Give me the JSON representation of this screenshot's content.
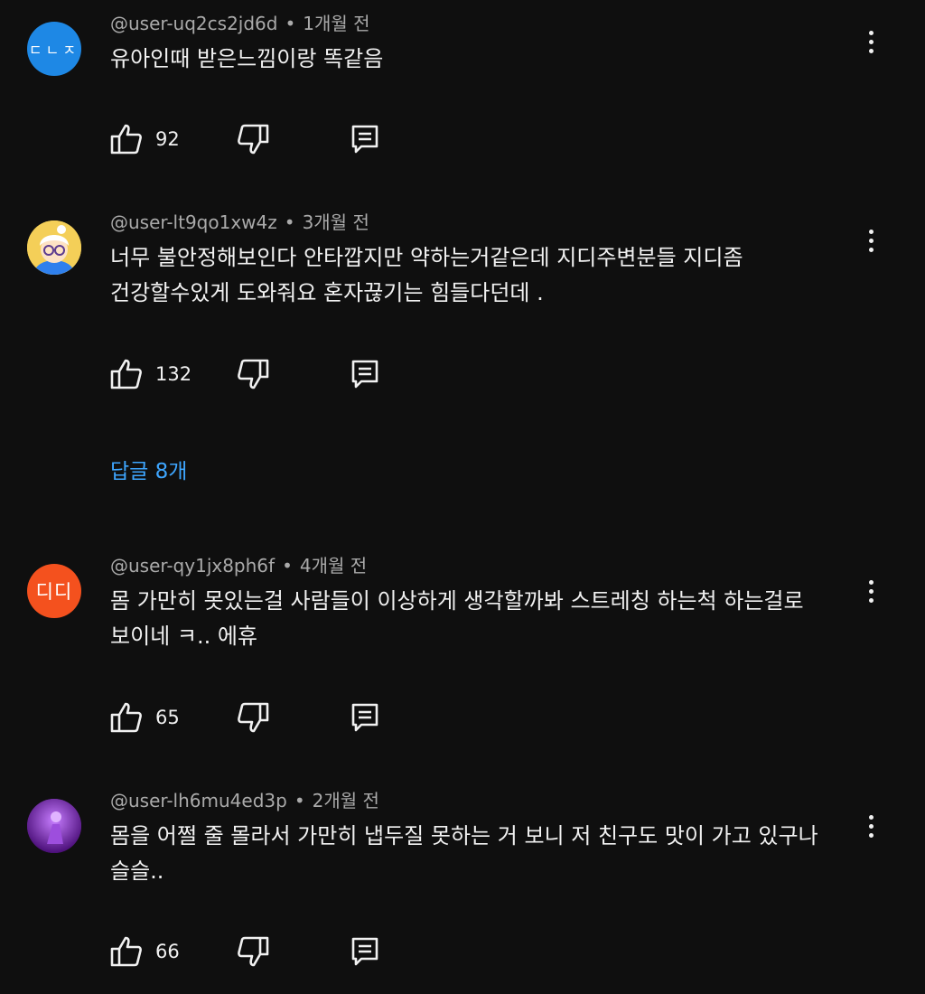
{
  "comments": [
    {
      "avatar_text": "ㄷㄴㅈ",
      "avatar_color": "#1e88e5",
      "username": "@user-uq2cs2jd6d",
      "time": "1개월 전",
      "lines": [
        "유아인때 받은느낌이랑 똑같음"
      ],
      "likes": "92"
    },
    {
      "avatar_text": "",
      "avatar_color": "#f2c94c",
      "username": "@user-lt9qo1xw4z",
      "time": "3개월 전",
      "lines": [
        "너무 불안정해보인다 안타깝지만 약하는거같은데 지디주변분들 지디좀",
        "건강할수있게 도와줘요 혼자끊기는 힘들다던데 ."
      ],
      "likes": "132"
    },
    {
      "avatar_text": "디디",
      "avatar_color": "#f4511e",
      "username": "@user-qy1jx8ph6f",
      "time": "4개월 전",
      "lines": [
        "몸 가만히 못있는걸 사람들이 이상하게 생각할까봐 스트레칭 하는척 하는걸로",
        "보이네 ㅋ.. 에휴"
      ],
      "likes": "65"
    },
    {
      "avatar_text": "",
      "avatar_color": "#7b1fa2",
      "username": "@user-lh6mu4ed3p",
      "time": "2개월 전",
      "lines": [
        "몸을 어쩔 줄 몰라서 가만히 냅두질 못하는 거 보니 저 친구도 맛이 가고 있구나",
        "슬슬.."
      ],
      "likes": "66"
    }
  ],
  "replies_label": "답글 8개",
  "icons": {
    "like": "thumbs-up-icon",
    "dislike": "thumbs-down-icon",
    "reply": "reply-icon",
    "menu": "more-vert-icon"
  },
  "colors": {
    "background": "#0f0f0f",
    "text": "#f1f1f1",
    "meta": "#aaaaaa",
    "link": "#3ea6ff"
  }
}
